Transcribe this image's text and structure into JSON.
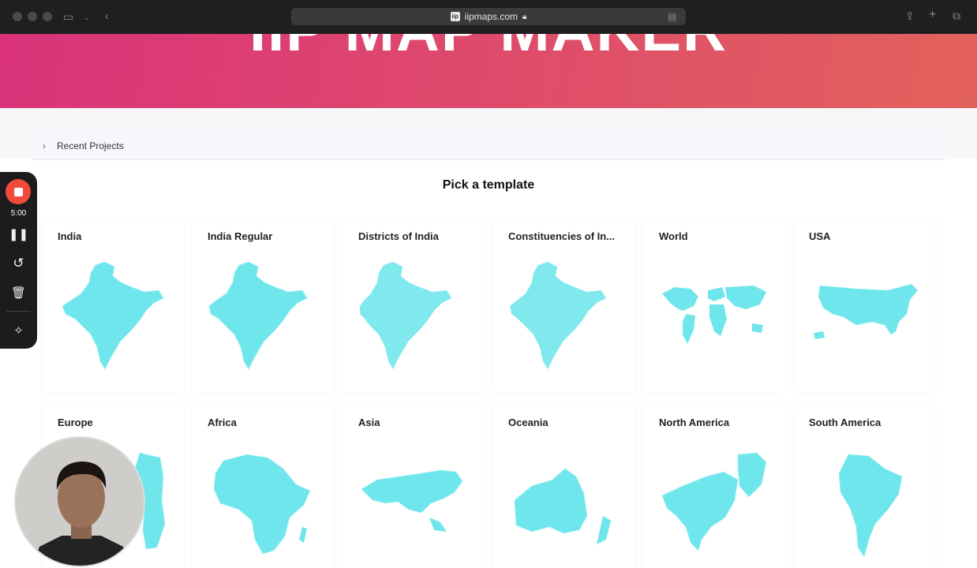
{
  "browser": {
    "url": "iipmaps.com"
  },
  "hero": {
    "title": "IIP MAP MAKER"
  },
  "recent_projects": {
    "label": "Recent Projects"
  },
  "templates": {
    "heading": "Pick a template",
    "row1": [
      {
        "name": "India"
      },
      {
        "name": "India Regular"
      },
      {
        "name": "Districts of India"
      },
      {
        "name": "Constituencies of In..."
      },
      {
        "name": "World"
      },
      {
        "name": "USA"
      }
    ],
    "row2": [
      {
        "name": "Europe"
      },
      {
        "name": "Africa"
      },
      {
        "name": "Asia"
      },
      {
        "name": "Oceania"
      },
      {
        "name": "North America"
      },
      {
        "name": "South America"
      }
    ]
  },
  "recorder": {
    "time": "5:00"
  },
  "colors": {
    "map_fill": "#6fe6ec",
    "hero_start": "#d9327a",
    "hero_end": "#e2625c",
    "record_red": "#f04a3a"
  }
}
